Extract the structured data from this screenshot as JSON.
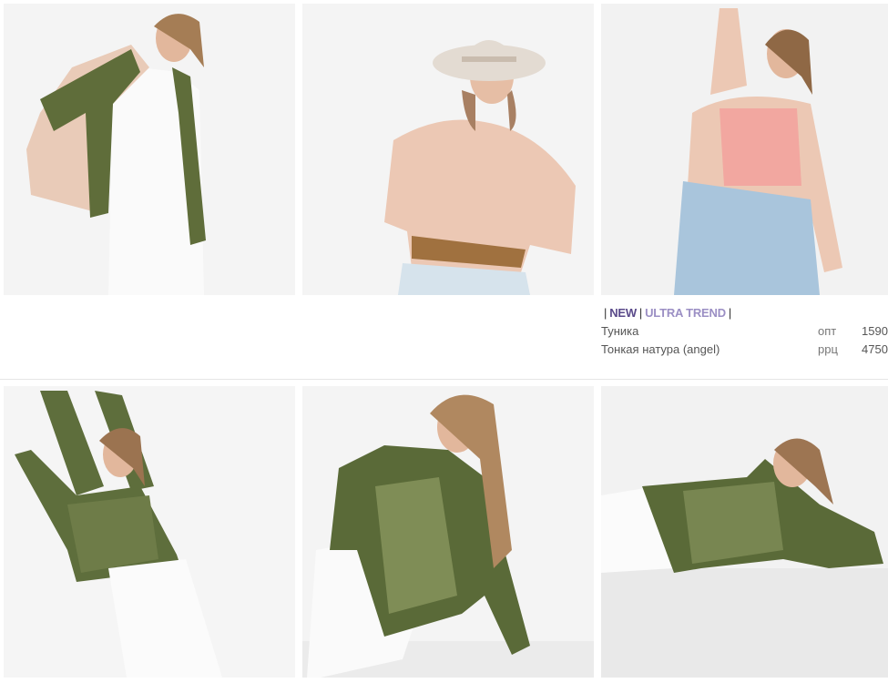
{
  "gallery": {
    "row1": [
      {
        "photo": "model-beige-green-cardigan-photo"
      },
      {
        "photo": "model-peach-sweater-hat-photo"
      },
      {
        "photo": "model-peach-tunic-jeans-photo"
      }
    ],
    "row2": [
      {
        "photo": "model-olive-tunic-standing-photo"
      },
      {
        "photo": "model-olive-tunic-sitting-photo"
      },
      {
        "photo": "model-olive-tunic-lying-photo"
      }
    ]
  },
  "product": {
    "badge_separator": "|",
    "badge_new": "NEW",
    "badge_trend": "ULTRA TREND",
    "name": "Туника",
    "collection": "Тонкая натура (angel)",
    "wholesale_label": "опт",
    "wholesale_price": "1590",
    "retail_label": "ррц",
    "retail_price": "4750"
  },
  "colors": {
    "peach": "#e9c3ae",
    "olive": "#5e6e3c",
    "badge_new": "#5a4a8a",
    "badge_trend": "#9b8fc4"
  }
}
